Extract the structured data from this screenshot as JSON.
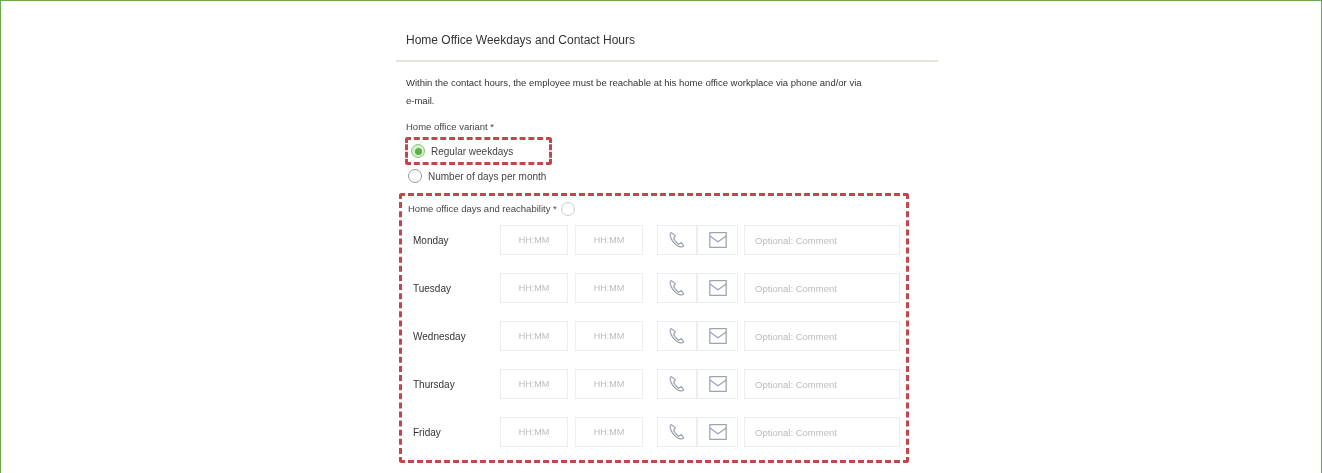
{
  "section": {
    "title": "Home Office Weekdays and Contact Hours"
  },
  "description": "Within the contact hours, the employee must be reachable at his home office workplace via phone and/or via e-mail.",
  "variant": {
    "label": "Home office variant *",
    "options": [
      {
        "label": "Regular weekdays",
        "selected": true
      },
      {
        "label": "Number of days per month",
        "selected": false
      }
    ]
  },
  "days": {
    "label": "Home office days and reachability *",
    "rows": [
      {
        "day": "Monday",
        "start_placeholder": "HH:MM",
        "end_placeholder": "HH:MM",
        "comment_placeholder": "Optional: Comment"
      },
      {
        "day": "Tuesday",
        "start_placeholder": "HH:MM",
        "end_placeholder": "HH:MM",
        "comment_placeholder": "Optional: Comment"
      },
      {
        "day": "Wednesday",
        "start_placeholder": "HH:MM",
        "end_placeholder": "HH:MM",
        "comment_placeholder": "Optional: Comment"
      },
      {
        "day": "Thursday",
        "start_placeholder": "HH:MM",
        "end_placeholder": "HH:MM",
        "comment_placeholder": "Optional: Comment"
      },
      {
        "day": "Friday",
        "start_placeholder": "HH:MM",
        "end_placeholder": "HH:MM",
        "comment_placeholder": "Optional: Comment"
      }
    ]
  }
}
